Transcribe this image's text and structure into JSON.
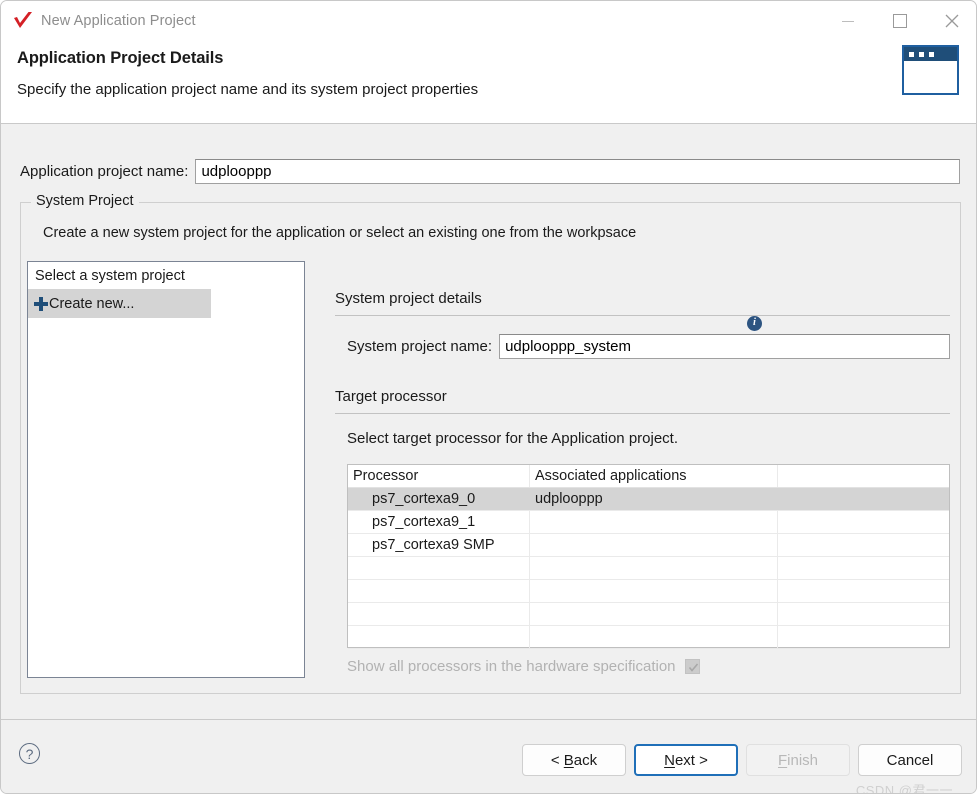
{
  "window": {
    "title": "New Application Project",
    "logo_icon": "red-check-logo",
    "controls": {
      "minimize": "minimize-icon",
      "maximize": "maximize-icon",
      "close": "close-icon"
    }
  },
  "header": {
    "title": "Application Project Details",
    "subtitle": "Specify the application project name and its system project properties",
    "banner_icon": "wizard-window-icon"
  },
  "application": {
    "name_label": "Application project name:",
    "name_value": "udplooppp",
    "name_placeholder": ""
  },
  "system_project": {
    "group_label": "System Project",
    "description": "Create a new system project for the application or select an existing one from the workpsace",
    "info_icon": "info-icon",
    "list": {
      "header": "Select a system project",
      "items": [
        {
          "label": "Create new...",
          "icon": "plus-icon",
          "selected": true
        }
      ]
    },
    "details": {
      "section_title": "System project details",
      "name_label": "System project name:",
      "name_value": "udplooppp_system",
      "name_placeholder": ""
    },
    "target": {
      "section_title": "Target processor",
      "description": "Select target processor for the Application project.",
      "table": {
        "columns": [
          "Processor",
          "Associated applications",
          ""
        ],
        "rows": [
          {
            "processor": "ps7_cortexa9_0",
            "applications": "udplooppp",
            "extra": "",
            "selected": true
          },
          {
            "processor": "ps7_cortexa9_1",
            "applications": "",
            "extra": "",
            "selected": false
          },
          {
            "processor": "ps7_cortexa9 SMP",
            "applications": "",
            "extra": "",
            "selected": false
          },
          {
            "processor": "",
            "applications": "",
            "extra": "",
            "selected": false
          },
          {
            "processor": "",
            "applications": "",
            "extra": "",
            "selected": false
          },
          {
            "processor": "",
            "applications": "",
            "extra": "",
            "selected": false
          },
          {
            "processor": "",
            "applications": "",
            "extra": "",
            "selected": false
          }
        ]
      },
      "show_all": {
        "label": "Show all processors in the hardware specification",
        "checked": true,
        "disabled": true,
        "info_icon": "info-icon"
      }
    }
  },
  "footer": {
    "help_icon": "help-question-icon",
    "buttons": {
      "back": {
        "prefix": "< ",
        "accel": "B",
        "rest": "ack",
        "disabled": false
      },
      "next": {
        "prefix": "",
        "accel": "N",
        "rest": "ext >",
        "disabled": false,
        "focused": true
      },
      "finish": {
        "prefix": "",
        "accel": "F",
        "rest": "inish",
        "disabled": true
      },
      "cancel": {
        "prefix": "",
        "accel": "",
        "rest": "Cancel",
        "disabled": false
      }
    },
    "watermark": "CSDN @君一一"
  },
  "colors": {
    "accent_blue": "#1f4e79",
    "focus_blue": "#1f6fb8",
    "logo_red": "#d42026",
    "selection_grey": "#d4d4d4",
    "dialog_bg": "#f0f0f0"
  }
}
